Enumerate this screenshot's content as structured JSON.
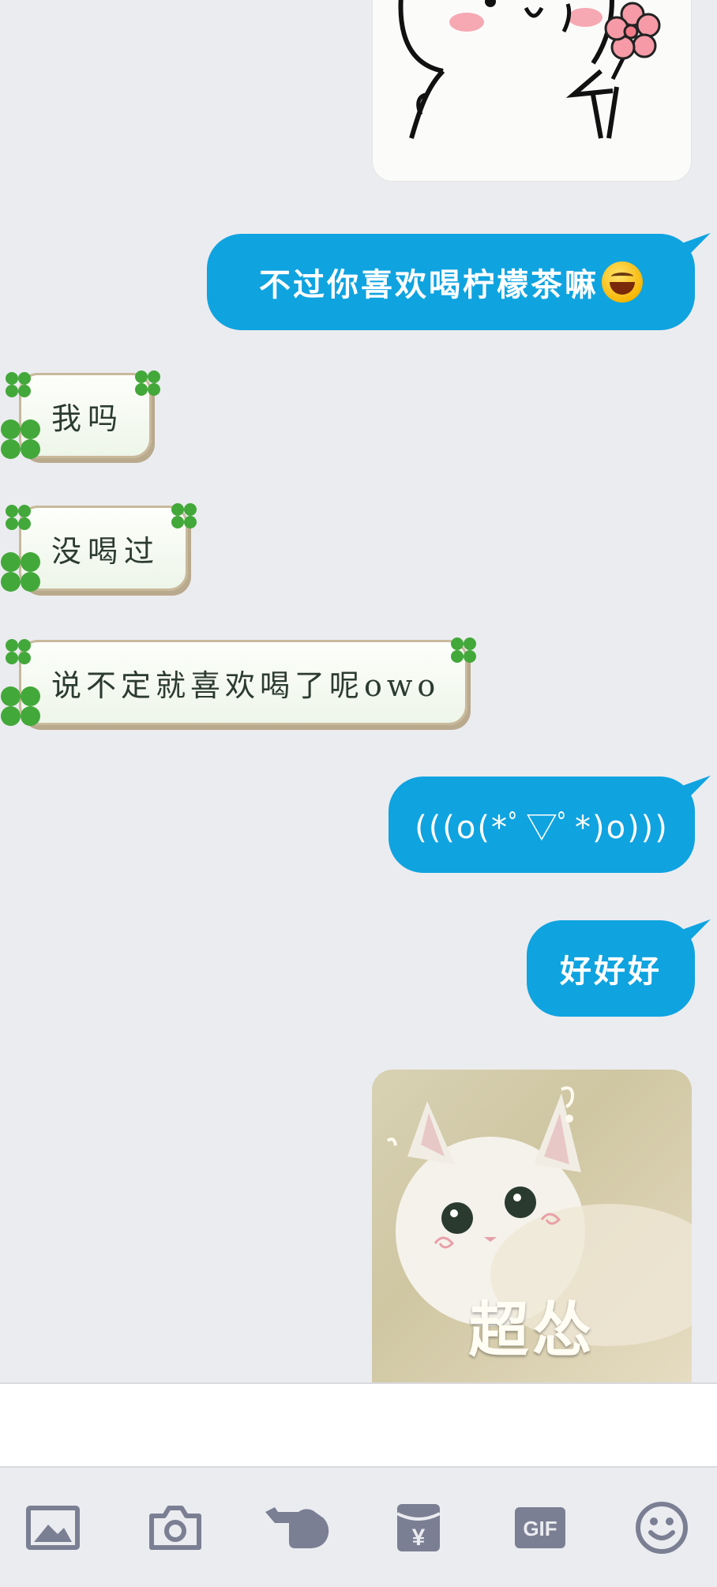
{
  "messages": {
    "sent_1": "不过你喜欢喝柠檬茶嘛",
    "received_1": "我吗",
    "received_2": "没喝过",
    "received_3": "说不定就喜欢喝了呢owo",
    "sent_2": "(((o(*ﾟ▽ﾟ*)o)))",
    "sent_3": "好好好"
  },
  "stickers": {
    "cat_caption": "超怂"
  },
  "toolbar": {
    "icons": [
      "image-icon",
      "camera-icon",
      "poke-icon",
      "red-packet-icon",
      "gif-icon",
      "emoji-icon"
    ],
    "gif_label": "GIF",
    "red_packet_symbol": "¥"
  },
  "colors": {
    "sent_bubble": "#0fa3e0",
    "background": "#ebecf0",
    "icon": "#7b7f93"
  }
}
